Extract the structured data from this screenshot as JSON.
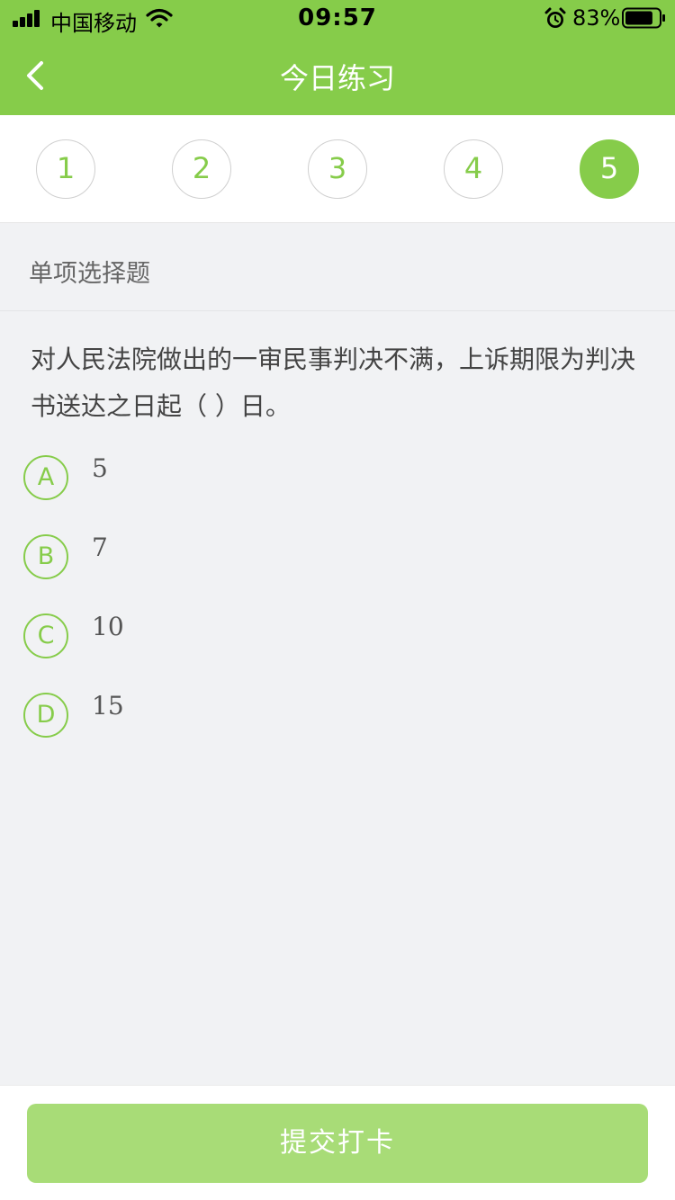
{
  "status_bar": {
    "carrier": "中国移动",
    "time": "09:57",
    "battery_percent": "83%",
    "battery_level": 0.83,
    "icons": [
      "signal-icon",
      "wifi-icon",
      "alarm-icon",
      "battery-icon"
    ]
  },
  "nav": {
    "title": "今日练习",
    "back_icon": "chevron-left-icon"
  },
  "question_numbers": [
    {
      "label": "1",
      "active": false
    },
    {
      "label": "2",
      "active": false
    },
    {
      "label": "3",
      "active": false
    },
    {
      "label": "4",
      "active": false
    },
    {
      "label": "5",
      "active": true
    }
  ],
  "question": {
    "type": "单项选择题",
    "text": "对人民法院做出的一审民事判决不满，上诉期限为判决书送达之日起（    ）日。",
    "options": [
      {
        "letter": "A",
        "value": "5"
      },
      {
        "letter": "B",
        "value": "7"
      },
      {
        "letter": "C",
        "value": "10"
      },
      {
        "letter": "D",
        "value": "15"
      }
    ]
  },
  "footer": {
    "submit_label": "提交打卡"
  },
  "colors": {
    "accent": "#86cc4a",
    "submit_disabled": "#a8dc77",
    "background": "#f1f2f4"
  }
}
